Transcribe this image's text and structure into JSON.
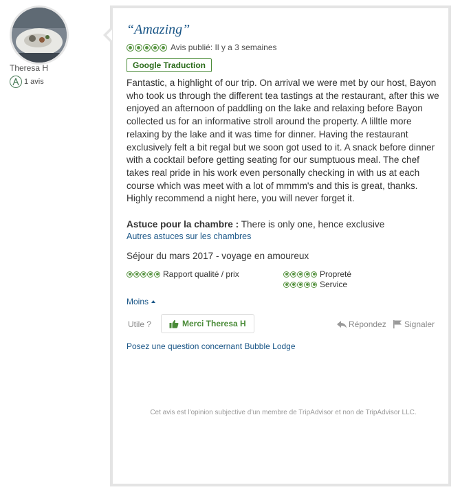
{
  "user": {
    "name": "Theresa H",
    "review_count": "1 avis",
    "avatar_icon": "user-avatar-photo",
    "badge_icon": "reviewer-badge-icon"
  },
  "review": {
    "title": "“Amazing”",
    "rating": 5,
    "rating_max": 5,
    "published": "Avis publié: Il y a 3 semaines",
    "translate_label": "Google Traduction",
    "text": "Fantastic, a highlight of our trip. On arrival we were met by our host, Bayon who took us through the different tea tastings at the restaurant, after this we enjoyed an afternoon of paddling on the lake and relaxing before Bayon collected us for an informative stroll around the property. A lilltle more relaxing by the lake and it was time for dinner. Having the restaurant exclusively felt a bit regal but we soon got used to it. A snack before dinner with a cocktail before getting seating for our sumptuous meal. The chef takes real pride in his work even personally checking in with us at each course which was meet with a lot of mmmm's and this is great, thanks. Highly recommend a night here, you will never forget it.",
    "tip_label": "Astuce pour la chambre :",
    "tip_text": " There is only one, hence exclusive",
    "other_tips_link": "Autres astuces sur les chambres",
    "stay": "Séjour du mars 2017 - voyage en amoureux",
    "sub_ratings": [
      {
        "label": "Rapport qualité / prix",
        "rating": 5
      },
      {
        "label": "Propreté",
        "rating": 5
      },
      {
        "label": "Service",
        "rating": 5
      }
    ],
    "less_link": "Moins",
    "useful_label": "Utile ?",
    "thanks_button": "Merci Theresa H",
    "reply_label": "Répondez",
    "report_label": "Signaler",
    "question_link": "Posez une question concernant Bubble Lodge",
    "disclaimer": "Cet avis est l'opinion subjective d'un membre de TripAdvisor et non de TripAdvisor LLC."
  },
  "colors": {
    "bubble": "#589442",
    "link": "#1a5687",
    "title": "#1a5687",
    "thanks": "#4a8b38"
  }
}
